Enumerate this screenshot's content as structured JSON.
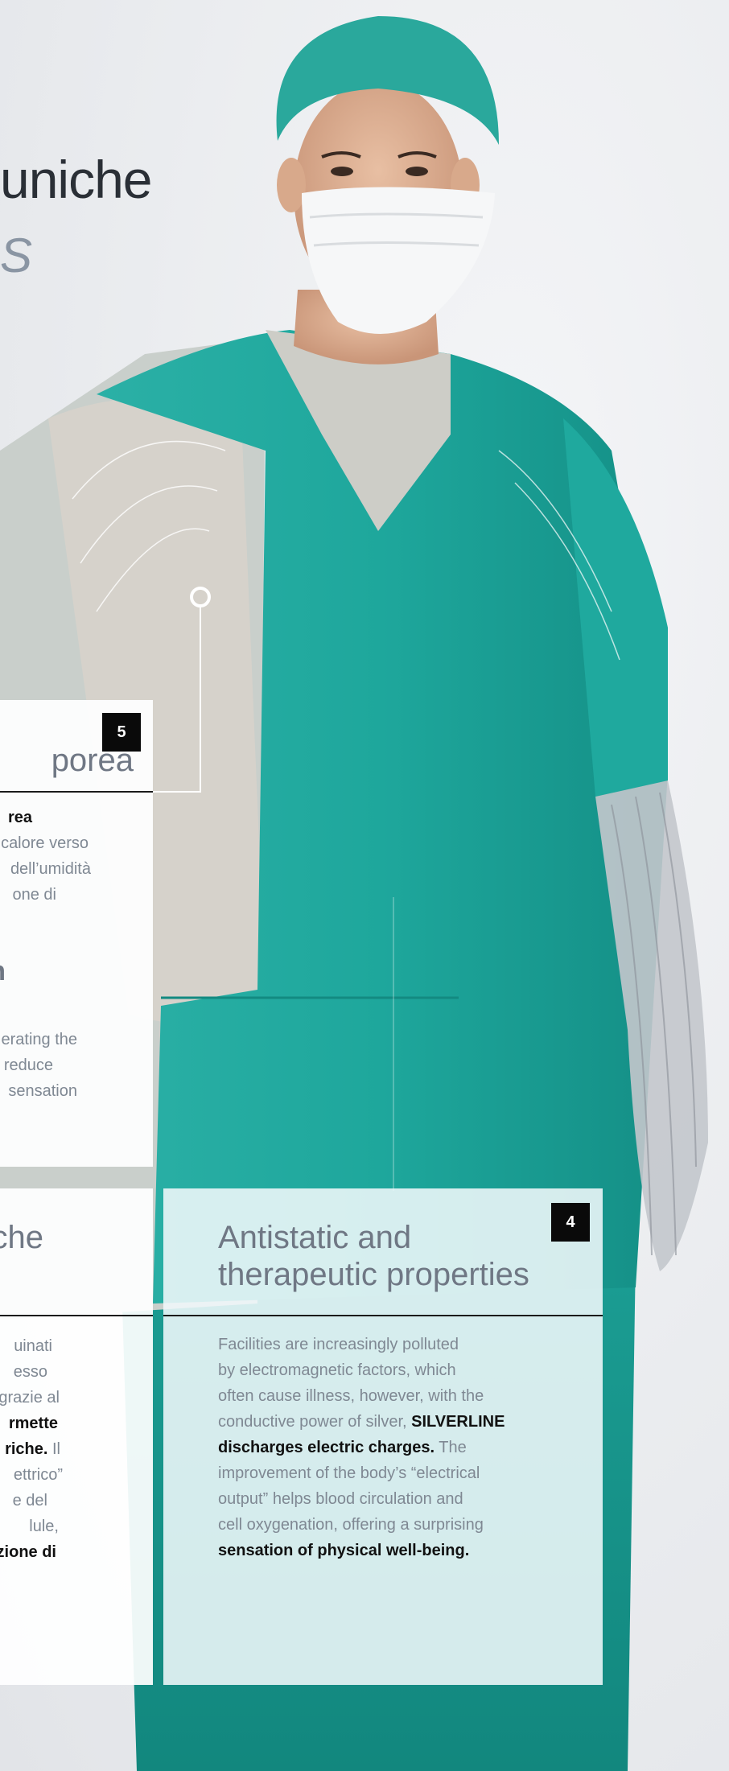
{
  "headline": {
    "line1": "uniche",
    "line2": "S"
  },
  "cards": {
    "card5": {
      "badge": "5",
      "title": "porea",
      "p1_bold": "rea",
      "p1_lines": [
        "calore verso",
        "dell’umidità",
        "one di"
      ],
      "sub_title": "n",
      "p2_lines": [
        "erating the",
        "reduce",
        "sensation"
      ]
    },
    "card_left_bottom": {
      "title": "che",
      "lines": [
        "uinati",
        "esso",
        "grazie al"
      ],
      "bold1": "rmette",
      "bold2": "riche.",
      "after_bold2": " Il",
      "lines2": [
        "ettrico”",
        "e del",
        "lule,"
      ],
      "bold3": "zione di"
    },
    "card4": {
      "badge": "4",
      "title_line1": "Antistatic and",
      "title_line2": "therapeutic properties",
      "body": {
        "l1": "Facilities are increasingly polluted",
        "l2": "by electromagnetic factors, which",
        "l3": "often cause illness, however, with the",
        "l4_pre": "conductive power of silver, ",
        "l4_bold": "SILVERLINE",
        "l5_bold": "discharges electric charges.",
        "l5_post": " The",
        "l6": "improvement of the body’s “electrical",
        "l7": "output” helps blood circulation and",
        "l8": "cell oxygenation, offering a surprising",
        "l9_bold": "sensation of physical well-being."
      }
    }
  }
}
